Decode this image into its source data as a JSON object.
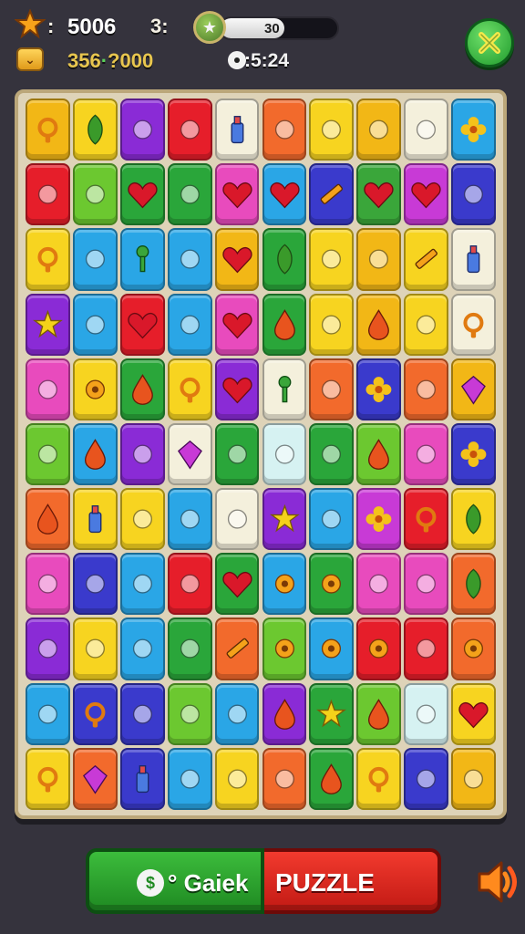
{
  "hud": {
    "score_label": ":",
    "score_value": "5006",
    "level_label": "3:",
    "progress_text": "30",
    "progress_fraction": 0.55,
    "coins_value_a": "356",
    "coins_value_b": "·",
    "coins_value_c": "?000",
    "timer_value": ":5:24",
    "star_icon": "star-icon",
    "badge_icon": "star-badge-icon",
    "coin_icon": "chevron-chest-icon",
    "timer_icon": "timer-icon",
    "close_icon": "close-x-icon"
  },
  "board": {
    "rows": 10,
    "cols": 10,
    "tile_colors": [
      [
        "#f2b716",
        "#f7d420",
        "#8a2bd6",
        "#e61e2a",
        "#f4f0dc",
        "#f26a2c",
        "#f7d420",
        "#f2b716",
        "#f4f0dc",
        "#2aa6e6"
      ],
      [
        "#e61e2a",
        "#6cc830",
        "#2aa63a",
        "#2aa63a",
        "#e84bbd",
        "#2aa6e6",
        "#3a3acc",
        "#3aa63a",
        "#c83ad6",
        "#3a3acc"
      ],
      [
        "#f7d420",
        "#2aa6e6",
        "#2aa6e6",
        "#2aa6e6",
        "#f2b716",
        "#2aa63a",
        "#f7d420",
        "#f2b716",
        "#f7d420",
        "#f4f0dc"
      ],
      [
        "#8a2bd6",
        "#2aa6e6",
        "#e61e2a",
        "#2aa6e6",
        "#e84bbd",
        "#2aa63a",
        "#f7d420",
        "#f2b716",
        "#f7d420",
        "#f4f0dc"
      ],
      [
        "#e84bbd",
        "#f7d420",
        "#2aa63a",
        "#f7d420",
        "#8a2bd6",
        "#f4f0dc",
        "#f26a2c",
        "#3a3acc",
        "#f26a2c",
        "#f2b716"
      ],
      [
        "#6cc830",
        "#2aa6e6",
        "#8a2bd6",
        "#f4f0dc",
        "#2aa63a",
        "#d6f2f2",
        "#2aa63a",
        "#6cc830",
        "#e84bbd",
        "#3a3acc"
      ],
      [
        "#f26a2c",
        "#f7d420",
        "#f7d420",
        "#2aa6e6",
        "#f4f0dc",
        "#8a2bd6",
        "#2aa6e6",
        "#c83ad6",
        "#e61e2a",
        "#f7d420"
      ],
      [
        "#e84bbd",
        "#3a3acc",
        "#2aa6e6",
        "#e61e2a",
        "#2aa63a",
        "#2aa6e6",
        "#2aa63a",
        "#e84bbd",
        "#e84bbd",
        "#f26a2c"
      ],
      [
        "#8a2bd6",
        "#f7d420",
        "#2aa6e6",
        "#2aa63a",
        "#f26a2c",
        "#6cc830",
        "#2aa6e6",
        "#e61e2a",
        "#e61e2a",
        "#f26a2c"
      ],
      [
        "#2aa6e6",
        "#3a3acc",
        "#3a3acc",
        "#6cc830",
        "#2aa6e6",
        "#8a2bd6",
        "#2aa63a",
        "#6cc830",
        "#d6f2f2",
        "#f7d420"
      ],
      [
        "#f7d420",
        "#f26a2c",
        "#3a3acc",
        "#2aa6e6",
        "#f7d420",
        "#f26a2c",
        "#2aa63a",
        "#f7d420",
        "#3a3acc",
        "#f2b716"
      ]
    ],
    "tile_icons": [
      [
        "ring",
        "leaf",
        "shield",
        "eraser",
        "bottle",
        "mirror",
        "book",
        "cross",
        "ghost",
        "flower"
      ],
      [
        "feather",
        "snail",
        "heart",
        "cheese",
        "heart",
        "heart",
        "pencil",
        "heart",
        "heart",
        "clover"
      ],
      [
        "ring",
        "bell",
        "key",
        "donut",
        "heart",
        "leaf",
        "tree",
        "house",
        "pencil",
        "bottle"
      ],
      [
        "star",
        "bat",
        "heart",
        "card",
        "heart",
        "drop",
        "cookie",
        "drop",
        "badge",
        "ring"
      ],
      [
        "crayon",
        "gear",
        "drop",
        "ring",
        "heart",
        "key",
        "pepper",
        "flower",
        "bean",
        "gem"
      ],
      [
        "virus",
        "drop",
        "bell",
        "gem",
        "house",
        "blob",
        "bear",
        "drop",
        "mirror",
        "flower"
      ],
      [
        "drop",
        "bottle",
        "ghost",
        "crayon",
        "phone",
        "star",
        "card",
        "flower",
        "ring",
        "leaf"
      ],
      [
        "feather",
        "paperclip",
        "lock",
        "bow",
        "heart",
        "gear",
        "gear",
        "ticket",
        "ticket",
        "leaf"
      ],
      [
        "sword",
        "puzzle",
        "moon",
        "bucket",
        "pencil",
        "gear",
        "gear",
        "gear",
        "wrench",
        "gear"
      ],
      [
        "snail",
        "ring",
        "snowman",
        "cheese",
        "card",
        "drop",
        "star",
        "drop",
        "blob",
        "heart"
      ],
      [
        "ring",
        "gem",
        "bottle",
        "sock",
        "bear",
        "cube",
        "drop",
        "ring",
        "hook",
        "spiral"
      ]
    ]
  },
  "bottom": {
    "quick_icon_glyph": "$",
    "quick_label": "° Gaiek",
    "puzzle_label": "PUZZLE",
    "sound_icon": "speaker-icon"
  }
}
